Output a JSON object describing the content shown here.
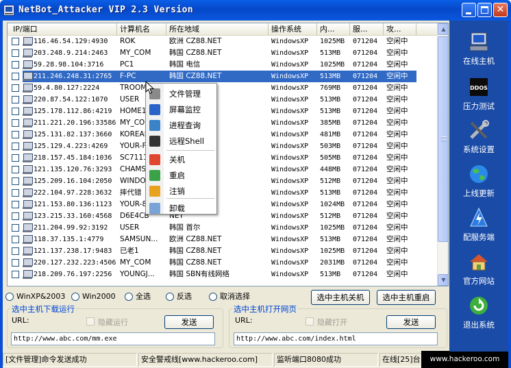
{
  "window": {
    "title": "NetBot_Attacker VIP 2.3 Version",
    "controls": {
      "minimize": "_",
      "maximize": "□",
      "close": "✕"
    }
  },
  "columns": [
    "IP/端口",
    "计算机名",
    "所在地域",
    "操作系统",
    "内...",
    "服...",
    "攻..."
  ],
  "rows": [
    {
      "ip": "116.46.54.129:4930",
      "name": "ROK",
      "region": "欧洲  CZ88.NET",
      "os": "WindowsXP",
      "mem": "1025MB",
      "svc": "071204",
      "atk": "空闲中"
    },
    {
      "ip": "203.248.9.214:2463",
      "name": "MY_COM",
      "region": "韩国  CZ88.NET",
      "os": "WindowsXP",
      "mem": "513MB",
      "svc": "071204",
      "atk": "空闲中"
    },
    {
      "ip": "59.28.98.104:3716",
      "name": "PC1",
      "region": "韩国 电信",
      "os": "WindowsXP",
      "mem": "1025MB",
      "svc": "071204",
      "atk": "空闲中"
    },
    {
      "ip": "211.246.248.31:2765",
      "name": "F-PC",
      "region": "韩国  CZ88.NET",
      "os": "WindowsXP",
      "mem": "513MB",
      "svc": "071204",
      "atk": "空闲中",
      "selected": true
    },
    {
      "ip": "59.4.80.127:2224",
      "name": "TROOM-",
      "region": "",
      "os": "WindowsXP",
      "mem": "769MB",
      "svc": "071204",
      "atk": "空闲中"
    },
    {
      "ip": "220.87.54.122:1070",
      "name": "USER",
      "region": "NET",
      "os": "WindowsXP",
      "mem": "513MB",
      "svc": "071204",
      "atk": "空闲中"
    },
    {
      "ip": "125.178.112.86:4219",
      "name": "HOME1-",
      "region": "NET",
      "os": "WindowsXP",
      "mem": "513MB",
      "svc": "071204",
      "atk": "空闲中"
    },
    {
      "ip": "211.221.20.196:33586",
      "name": "MY_COM",
      "region": "NET",
      "os": "WindowsXP",
      "mem": "385MB",
      "svc": "071204",
      "atk": "空闲中"
    },
    {
      "ip": "125.131.82.137:3660",
      "name": "KOREAN",
      "region": "司",
      "os": "WindowsXP",
      "mem": "481MB",
      "svc": "071204",
      "atk": "空闲中"
    },
    {
      "ip": "125.129.4.223:4269",
      "name": "YOUR-F",
      "region": "司",
      "os": "WindowsXP",
      "mem": "503MB",
      "svc": "071204",
      "atk": "空闲中"
    },
    {
      "ip": "218.157.45.184:1036",
      "name": "SC7111",
      "region": "NET",
      "os": "WindowsXP",
      "mem": "505MB",
      "svc": "071204",
      "atk": "空闲中"
    },
    {
      "ip": "121.135.120.76:3293",
      "name": "CHAMSA",
      "region": "NET",
      "os": "WindowsXP",
      "mem": "448MB",
      "svc": "071204",
      "atk": "空闲中"
    },
    {
      "ip": "125.209.16.104:2050",
      "name": "WINDOW",
      "region": "NET",
      "os": "WindowsXP",
      "mem": "512MB",
      "svc": "071204",
      "atk": "空闲中"
    },
    {
      "ip": "222.104.97.228:3632",
      "name": "摔代错",
      "region": "NET",
      "os": "WindowsXP",
      "mem": "513MB",
      "svc": "071204",
      "atk": "空闲中"
    },
    {
      "ip": "121.153.80.136:1123",
      "name": "YOUR-8",
      "region": "NET",
      "os": "WindowsXP",
      "mem": "1024MB",
      "svc": "071204",
      "atk": "空闲中"
    },
    {
      "ip": "123.215.33.160:4568",
      "name": "D6E4CB",
      "region": "NET",
      "os": "WindowsXP",
      "mem": "512MB",
      "svc": "071204",
      "atk": "空闲中"
    },
    {
      "ip": "211.204.99.92:3192",
      "name": "USER",
      "region": "韩国 首尔",
      "os": "WindowsXP",
      "mem": "1025MB",
      "svc": "071204",
      "atk": "空闲中"
    },
    {
      "ip": "118.37.135.1:4779",
      "name": "SAMSUN...",
      "region": "欧洲  CZ88.NET",
      "os": "WindowsXP",
      "mem": "513MB",
      "svc": "071204",
      "atk": "空闲中"
    },
    {
      "ip": "121.137.238.17:9483",
      "name": "已老1",
      "region": "韩国  CZ88.NET",
      "os": "WindowsXP",
      "mem": "1025MB",
      "svc": "071204",
      "atk": "空闲中"
    },
    {
      "ip": "220.127.232.223:4506",
      "name": "MY_COM",
      "region": "韩国  CZ88.NET",
      "os": "WindowsXP",
      "mem": "2031MB",
      "svc": "071204",
      "atk": "空闲中"
    },
    {
      "ip": "218.209.76.197:2256",
      "name": "YOUNGJ...",
      "region": "韩国 SBN有线网络",
      "os": "WindowsXP",
      "mem": "513MB",
      "svc": "071204",
      "atk": "空闲中"
    }
  ],
  "context_menu": [
    {
      "label": "文件管理",
      "icon": "folder-icon",
      "color": "#8a8a8a"
    },
    {
      "label": "屏幕监控",
      "icon": "monitor-icon",
      "color": "#2a63c8"
    },
    {
      "label": "进程查询",
      "icon": "process-icon",
      "color": "#3a83c9"
    },
    {
      "label": "远程Shell",
      "icon": "shell-icon",
      "color": "#333333"
    },
    {
      "label": "关机",
      "icon": "power-icon",
      "color": "#e0452f"
    },
    {
      "label": "重启",
      "icon": "restart-icon",
      "color": "#3aa348"
    },
    {
      "label": "注销",
      "icon": "logoff-icon",
      "color": "#e8a21e"
    },
    {
      "label": "卸载",
      "icon": "uninstall-icon",
      "color": "#7aa3d8"
    }
  ],
  "radio_options": [
    "WinXP&2003",
    "Win2000",
    "全选",
    "反选",
    "取消选择"
  ],
  "buttons": {
    "shutdown_selected": "选中主机关机",
    "restart_selected": "选中主机重启"
  },
  "download_group": {
    "title": "选中主机下载运行",
    "url_label": "URL:",
    "hidden_label": "隐藏运行",
    "send_label": "发送",
    "url_value": "http://www.abc.com/mm.exe"
  },
  "open_group": {
    "title": "选中主机打开网页",
    "url_label": "URL:",
    "hidden_label": "隐藏打开",
    "send_label": "发送",
    "url_value": "http://www.abc.com/index.html"
  },
  "statusbar": [
    "[文件管理]命令发送成功",
    "安全警戒线[www.hackeroo.com]",
    "监听端口8080成功",
    "在线[25]台"
  ],
  "watermark": "www.hackeroo.com",
  "right_panel": [
    {
      "label": "在线主机",
      "icon": "computer-icon"
    },
    {
      "label": "压力测试",
      "icon": "ddos-icon",
      "badge": "DDOS"
    },
    {
      "label": "系统设置",
      "icon": "tools-icon"
    },
    {
      "label": "上线更新",
      "icon": "globe-icon"
    },
    {
      "label": "配服务端",
      "icon": "server-config-icon"
    },
    {
      "label": "官方网站",
      "icon": "home-icon"
    },
    {
      "label": "退出系统",
      "icon": "exit-icon"
    }
  ],
  "colors": {
    "selection": "#316ac5",
    "titlebar": "#0a5ee6",
    "right_panel": "#1a4ba6",
    "group_title": "#0046d5"
  }
}
